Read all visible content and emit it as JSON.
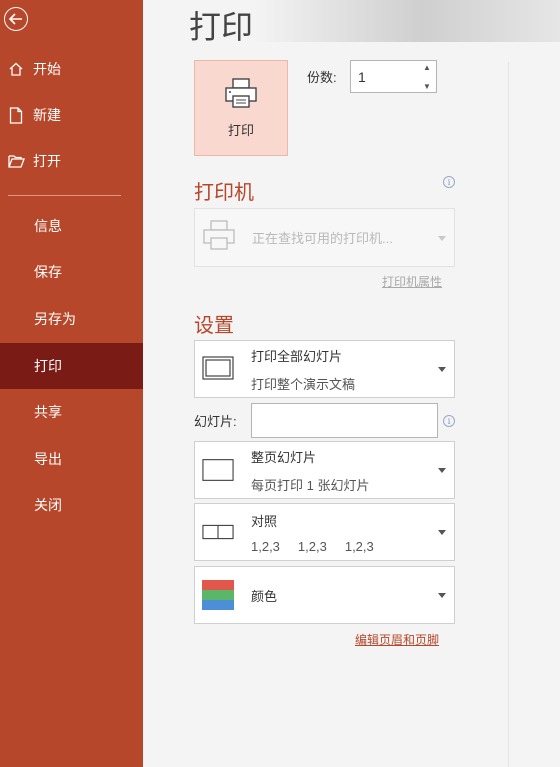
{
  "sidebar": {
    "items": [
      {
        "label": "开始",
        "icon": "home-icon"
      },
      {
        "label": "新建",
        "icon": "new-file-icon"
      },
      {
        "label": "打开",
        "icon": "open-folder-icon"
      },
      {
        "label": "信息"
      },
      {
        "label": "保存"
      },
      {
        "label": "另存为"
      },
      {
        "label": "打印",
        "active": true
      },
      {
        "label": "共享"
      },
      {
        "label": "导出"
      },
      {
        "label": "关闭"
      }
    ]
  },
  "main": {
    "title": "打印",
    "print_button_label": "打印",
    "copies": {
      "label": "份数:",
      "value": "1"
    },
    "printer": {
      "section_title": "打印机",
      "status": "正在查找可用的打印机...",
      "properties_link": "打印机属性"
    },
    "settings": {
      "section_title": "设置",
      "range": {
        "title": "打印全部幻灯片",
        "subtitle": "打印整个演示文稿"
      },
      "slides_label": "幻灯片:",
      "slides_value": "",
      "layout": {
        "title": "整页幻灯片",
        "subtitle": "每页打印 1 张幻灯片"
      },
      "collate": {
        "title": "对照",
        "values": [
          "1,2,3",
          "1,2,3",
          "1,2,3"
        ]
      },
      "color": {
        "title": "颜色"
      },
      "header_footer_link": "编辑页眉和页脚"
    }
  },
  "colors": {
    "accent": "#b7472a",
    "active_nav": "#7a1c15",
    "print_button_bg": "#f9d8cf"
  }
}
